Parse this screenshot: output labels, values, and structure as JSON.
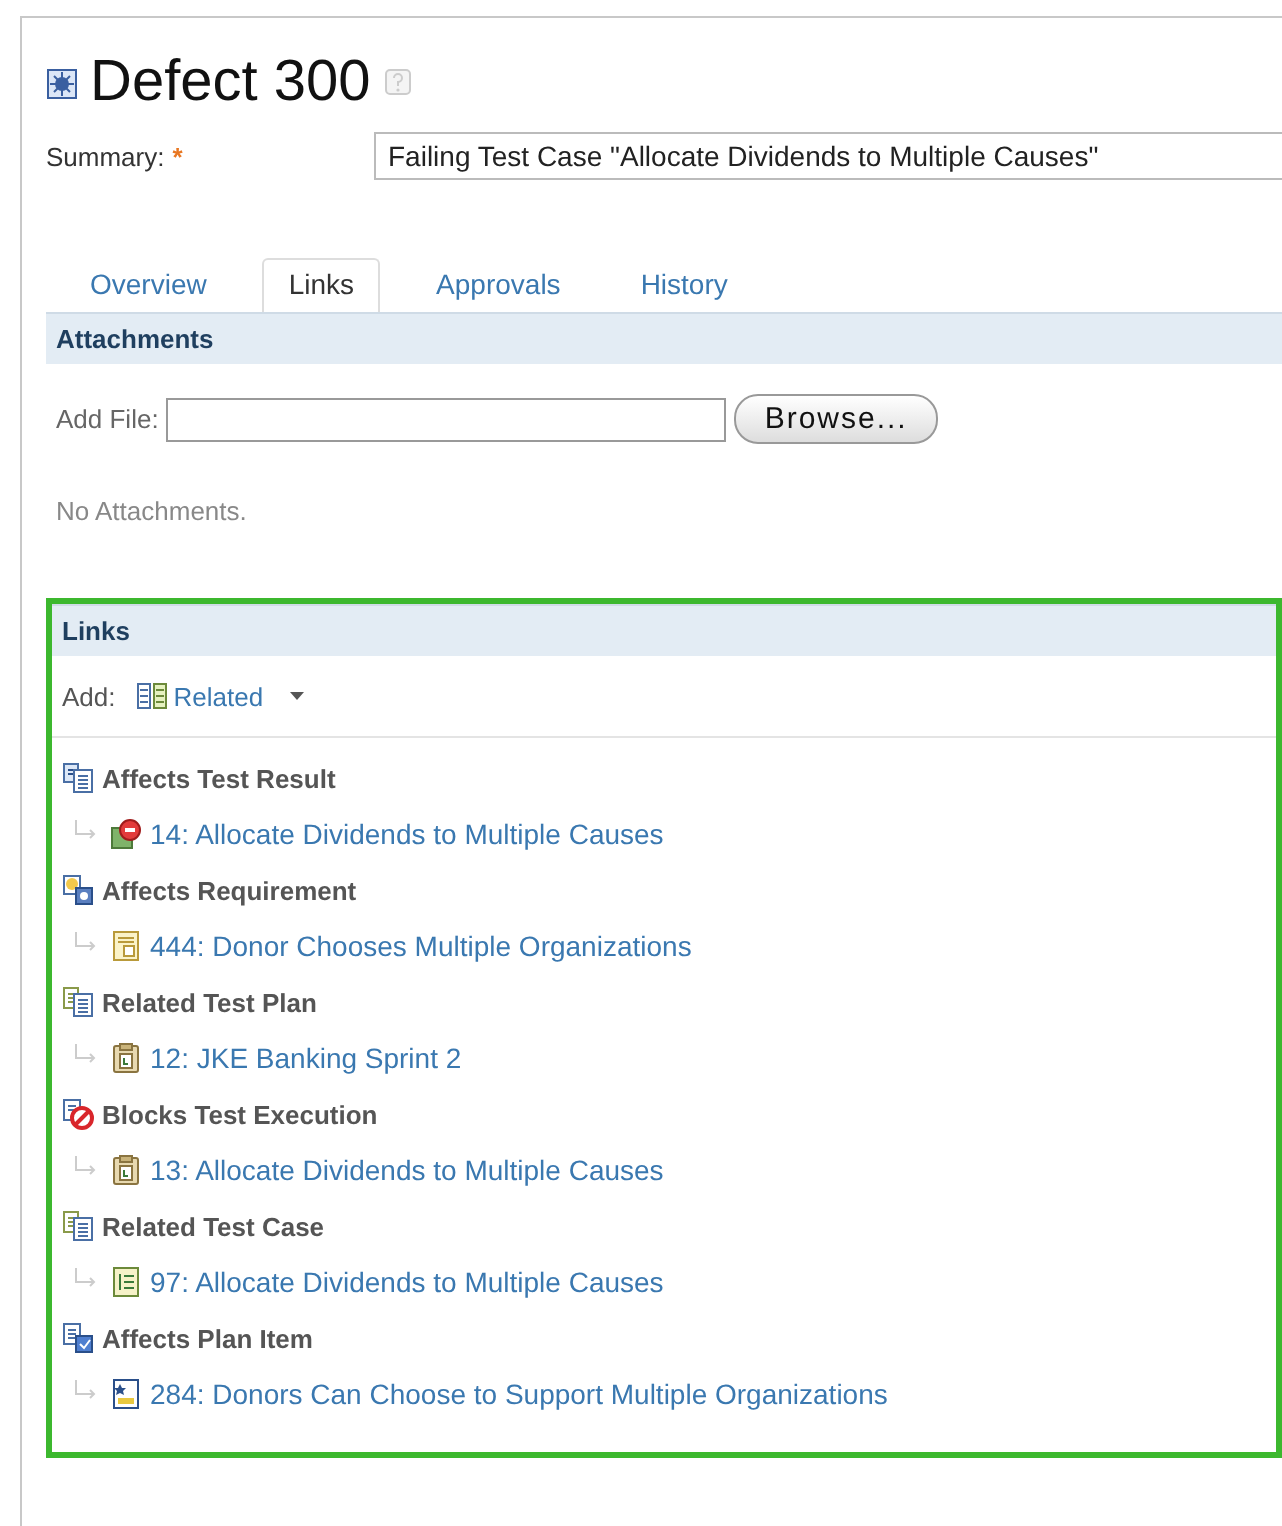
{
  "title": "Defect 300",
  "summary": {
    "label": "Summary:",
    "required_mark": "*",
    "value": "Failing Test Case \"Allocate Dividends to Multiple Causes\""
  },
  "tabs": [
    {
      "label": "Overview",
      "selected": false
    },
    {
      "label": "Links",
      "selected": true
    },
    {
      "label": "Approvals",
      "selected": false
    },
    {
      "label": "History",
      "selected": false
    }
  ],
  "attachments": {
    "heading": "Attachments",
    "add_file_label": "Add File:",
    "browse_button": "Browse...",
    "empty_text": "No Attachments."
  },
  "links": {
    "heading": "Links",
    "add_label": "Add:",
    "add_menu": "Related",
    "groups": [
      {
        "label": "Affects Test Result",
        "kind": "result",
        "items": [
          {
            "text": "14: Allocate Dividends to Multiple Causes",
            "kind": "failed"
          }
        ]
      },
      {
        "label": "Affects Requirement",
        "kind": "requirement",
        "items": [
          {
            "text": "444: Donor Chooses Multiple Organizations",
            "kind": "document"
          }
        ]
      },
      {
        "label": "Related Test Plan",
        "kind": "related",
        "items": [
          {
            "text": "12: JKE Banking Sprint 2",
            "kind": "clipboard"
          }
        ]
      },
      {
        "label": "Blocks Test Execution",
        "kind": "blocks",
        "items": [
          {
            "text": "13: Allocate Dividends to Multiple Causes",
            "kind": "clipboard"
          }
        ]
      },
      {
        "label": "Related Test Case",
        "kind": "related",
        "items": [
          {
            "text": "97: Allocate Dividends to Multiple Causes",
            "kind": "list"
          }
        ]
      },
      {
        "label": "Affects Plan Item",
        "kind": "plan",
        "items": [
          {
            "text": "284: Donors Can Choose to Support Multiple Organizations",
            "kind": "story"
          }
        ]
      }
    ]
  }
}
